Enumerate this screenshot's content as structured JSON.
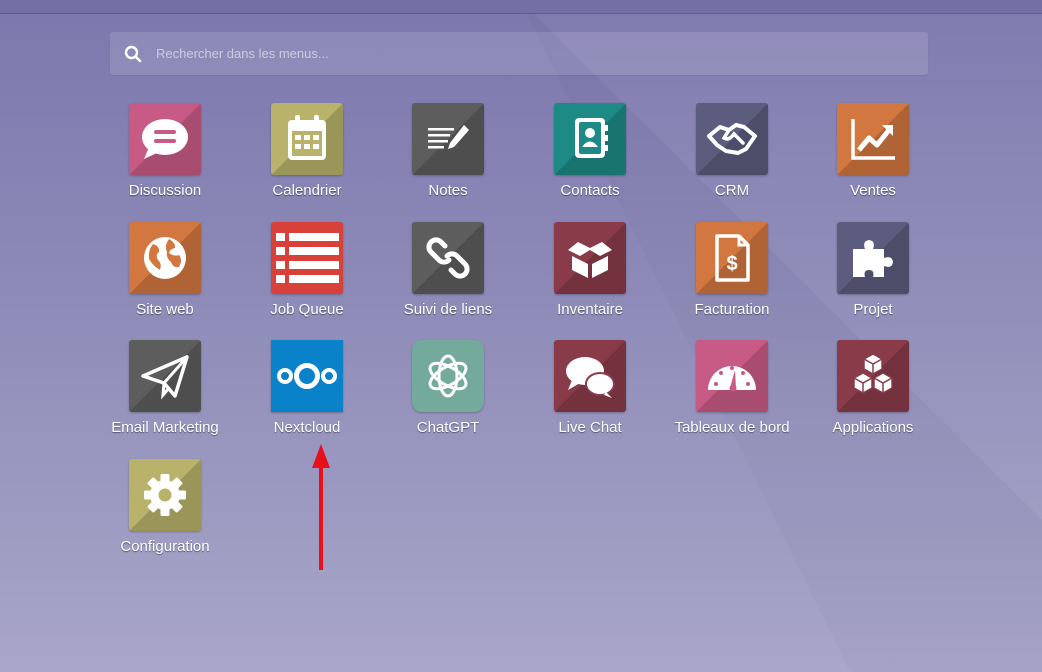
{
  "search": {
    "placeholder": "Rechercher dans les menus...",
    "value": ""
  },
  "apps": [
    {
      "id": "discussion",
      "label": "Discussion",
      "color": "#c85a86",
      "icon": "chat-bubble-icon"
    },
    {
      "id": "calendrier",
      "label": "Calendrier",
      "color": "#b8b26a",
      "icon": "calendar-icon"
    },
    {
      "id": "notes",
      "label": "Notes",
      "color": "#5d5d5d",
      "icon": "notes-pen-icon"
    },
    {
      "id": "contacts",
      "label": "Contacts",
      "color": "#1e8a85",
      "icon": "address-book-icon"
    },
    {
      "id": "crm",
      "label": "CRM",
      "color": "#5c5c7e",
      "icon": "handshake-icon"
    },
    {
      "id": "ventes",
      "label": "Ventes",
      "color": "#d2773f",
      "icon": "chart-up-icon"
    },
    {
      "id": "site-web",
      "label": "Site web",
      "color": "#d2773f",
      "icon": "globe-icon"
    },
    {
      "id": "job-queue",
      "label": "Job Queue",
      "color": "#d8413a",
      "icon": "list-icon"
    },
    {
      "id": "suivi-de-liens",
      "label": "Suivi de liens",
      "color": "#5d5d5d",
      "icon": "link-icon"
    },
    {
      "id": "inventaire",
      "label": "Inventaire",
      "color": "#8a3b4a",
      "icon": "box-icon"
    },
    {
      "id": "facturation",
      "label": "Facturation",
      "color": "#d2773f",
      "icon": "invoice-dollar-icon"
    },
    {
      "id": "projet",
      "label": "Projet",
      "color": "#5c5c7e",
      "icon": "puzzle-icon"
    },
    {
      "id": "email-marketing",
      "label": "Email Marketing",
      "color": "#5d5d5d",
      "icon": "paper-plane-icon"
    },
    {
      "id": "nextcloud",
      "label": "Nextcloud",
      "color": "#0a82c9",
      "icon": "nextcloud-logo-icon"
    },
    {
      "id": "chatgpt",
      "label": "ChatGPT",
      "color": "#74aa9c",
      "icon": "openai-logo-icon"
    },
    {
      "id": "live-chat",
      "label": "Live Chat",
      "color": "#8a3b4a",
      "icon": "chat-bubbles-icon"
    },
    {
      "id": "tableaux-de-bord",
      "label": "Tableaux de bord",
      "color": "#c85a86",
      "icon": "gauge-icon"
    },
    {
      "id": "applications",
      "label": "Applications",
      "color": "#8a3b4a",
      "icon": "cubes-icon"
    },
    {
      "id": "configuration",
      "label": "Configuration",
      "color": "#b8b26a",
      "icon": "gear-icon"
    }
  ],
  "annotation": {
    "arrow_color": "#e8101a",
    "icon": "red-arrow-annotation"
  }
}
